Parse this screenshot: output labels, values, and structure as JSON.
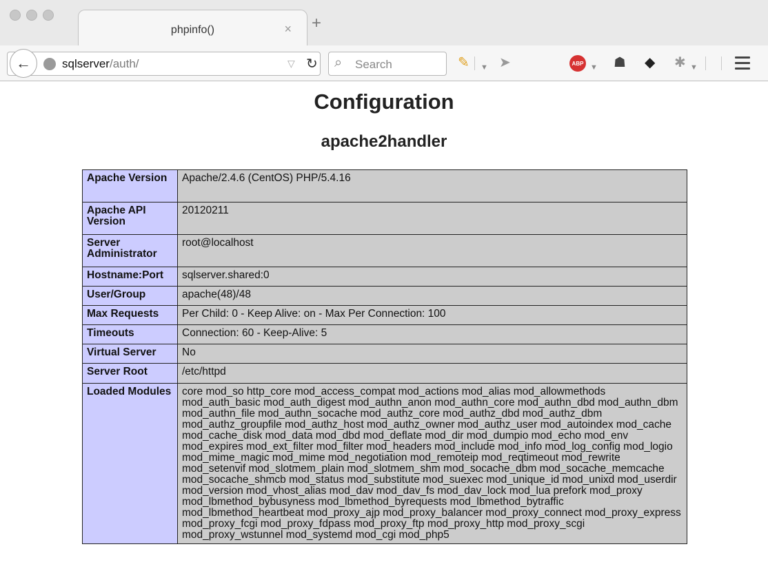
{
  "browser": {
    "tab_title": "phpinfo()",
    "tab_close": "×",
    "new_tab": "+",
    "url_host": "sqlserver",
    "url_path": "/auth/",
    "search_placeholder": "Search",
    "abp_label": "ABP",
    "icons": {
      "back": "back-arrow-icon",
      "site": "globe-icon",
      "reload": "reload-icon",
      "search": "magnifier-icon",
      "pencil": "pencil-icon",
      "send": "send-icon",
      "ghost": "ghostery-icon",
      "tag": "tag-icon",
      "bee": "bee-icon",
      "menu": "hamburger-menu-icon"
    }
  },
  "page": {
    "title": "Configuration",
    "subtitle": "apache2handler"
  },
  "config_rows": [
    {
      "key": "Apache Version",
      "value": "Apache/2.4.6 (CentOS) PHP/5.4.16"
    },
    {
      "key": "Apache API Version",
      "value": "20120211"
    },
    {
      "key": "Server Administrator",
      "value": "root@localhost"
    },
    {
      "key": "Hostname:Port",
      "value": "sqlserver.shared:0"
    },
    {
      "key": "User/Group",
      "value": "apache(48)/48"
    },
    {
      "key": "Max Requests",
      "value": "Per Child: 0 - Keep Alive: on - Max Per Connection: 100"
    },
    {
      "key": "Timeouts",
      "value": "Connection: 60 - Keep-Alive: 5"
    },
    {
      "key": "Virtual Server",
      "value": "No"
    },
    {
      "key": "Server Root",
      "value": "/etc/httpd"
    },
    {
      "key": "Loaded Modules",
      "value": "core mod_so http_core mod_access_compat mod_actions mod_alias mod_allowmethods mod_auth_basic mod_auth_digest mod_authn_anon mod_authn_core mod_authn_dbd mod_authn_dbm mod_authn_file mod_authn_socache mod_authz_core mod_authz_dbd mod_authz_dbm mod_authz_groupfile mod_authz_host mod_authz_owner mod_authz_user mod_autoindex mod_cache mod_cache_disk mod_data mod_dbd mod_deflate mod_dir mod_dumpio mod_echo mod_env mod_expires mod_ext_filter mod_filter mod_headers mod_include mod_info mod_log_config mod_logio mod_mime_magic mod_mime mod_negotiation mod_remoteip mod_reqtimeout mod_rewrite mod_setenvif mod_slotmem_plain mod_slotmem_shm mod_socache_dbm mod_socache_memcache mod_socache_shmcb mod_status mod_substitute mod_suexec mod_unique_id mod_unixd mod_userdir mod_version mod_vhost_alias mod_dav mod_dav_fs mod_dav_lock mod_lua prefork mod_proxy mod_lbmethod_bybusyness mod_lbmethod_byrequests mod_lbmethod_bytraffic mod_lbmethod_heartbeat mod_proxy_ajp mod_proxy_balancer mod_proxy_connect mod_proxy_express mod_proxy_fcgi mod_proxy_fdpass mod_proxy_ftp mod_proxy_http mod_proxy_scgi mod_proxy_wstunnel mod_systemd mod_cgi mod_php5"
    }
  ]
}
